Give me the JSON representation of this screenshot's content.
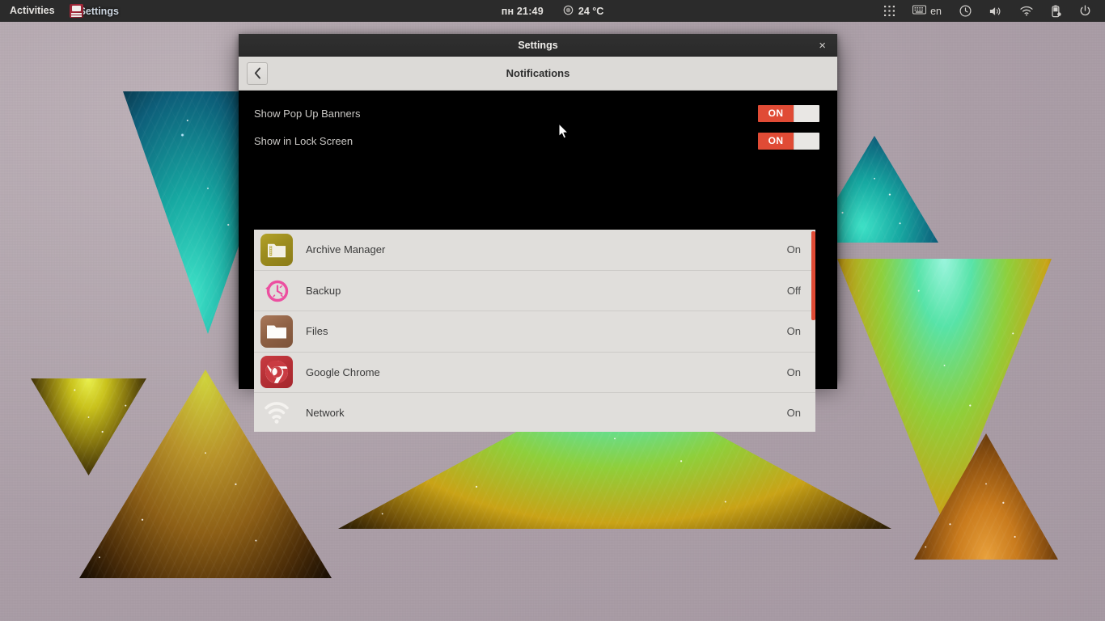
{
  "topbar": {
    "activities": "Activities",
    "window_label": "Settings",
    "window_icon": "settings-app-icon",
    "clock": "пн 21:49",
    "weather": {
      "icon": "weather-icon",
      "value": "24 °C"
    },
    "tray": [
      {
        "name": "app-grid-icon",
        "label": ""
      },
      {
        "name": "keyboard-layout-icon",
        "label": "en"
      },
      {
        "name": "clock-status-icon",
        "label": ""
      },
      {
        "name": "volume-icon",
        "label": ""
      },
      {
        "name": "wifi-icon",
        "label": ""
      },
      {
        "name": "battery-icon",
        "label": ""
      },
      {
        "name": "power-icon",
        "label": ""
      }
    ]
  },
  "window": {
    "title": "Settings",
    "close_label": "×",
    "back_label": "‹",
    "page_title": "Notifications"
  },
  "settings": {
    "toggles": [
      {
        "label": "Show Pop Up Banners",
        "state": "ON"
      },
      {
        "label": "Show in Lock Screen",
        "state": "ON"
      }
    ],
    "apps": [
      {
        "name": "Archive Manager",
        "state": "On",
        "icon": "archive-manager-icon"
      },
      {
        "name": "Backup",
        "state": "Off",
        "icon": "backup-icon"
      },
      {
        "name": "Files",
        "state": "On",
        "icon": "files-icon"
      },
      {
        "name": "Google Chrome",
        "state": "On",
        "icon": "google-chrome-icon"
      },
      {
        "name": "Network",
        "state": "On",
        "icon": "network-icon"
      }
    ]
  },
  "colors": {
    "accent_red": "#e04b35",
    "titlebar": "#2b2b2b",
    "content_bg": "#000000",
    "list_bg": "#e0dedb",
    "header_bg": "#dcdad7",
    "desktop": "#b0a4ac"
  }
}
